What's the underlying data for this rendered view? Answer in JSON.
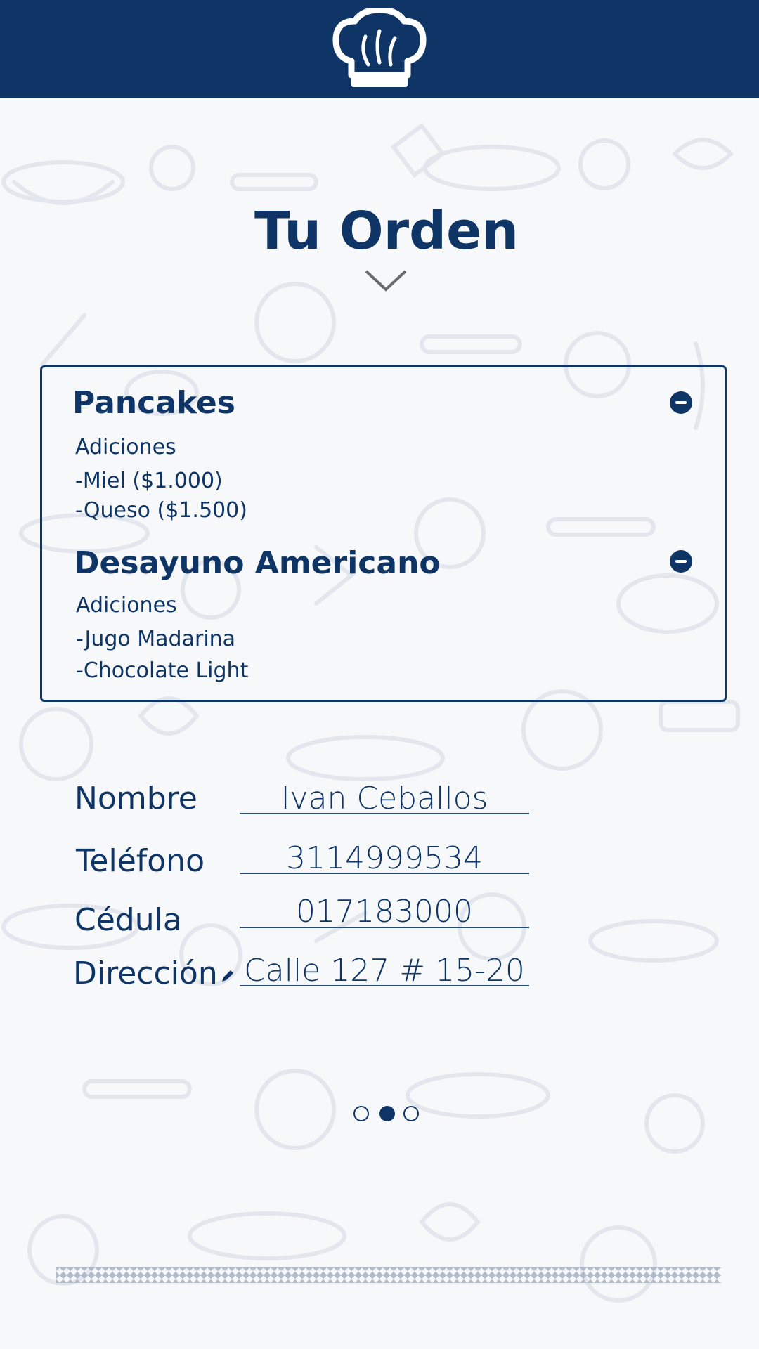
{
  "header": {
    "logo_icon": "chef-hat-icon",
    "background": "#0f3566"
  },
  "page": {
    "title": "Tu Orden",
    "chevron_icon": "chevron-down-icon"
  },
  "order": {
    "items": [
      {
        "name": "Pancakes",
        "additions_title": "Adiciones",
        "additions": [
          "-Miel ($1.000)",
          "-Queso ($1.500)"
        ],
        "remove_icon": "minus-circle-icon"
      },
      {
        "name": "Desayuno Americano",
        "additions_title": "Adiciones",
        "additions": [
          "-Jugo Madarina",
          "-Chocolate Light"
        ],
        "remove_icon": "minus-circle-icon"
      }
    ]
  },
  "form": {
    "name_label": "Nombre",
    "name_value": "Ivan Ceballos",
    "phone_label": "Teléfono",
    "phone_value": "3114999534",
    "id_label": "Cédula",
    "id_value": "017183000",
    "address_label": "Dirección",
    "address_value": "Calle 127 # 15-20",
    "edit_icon": "pencil-icon"
  },
  "pagination": {
    "total": 3,
    "current": 2
  },
  "colors": {
    "primary": "#0f3566",
    "background": "#f7f8fa",
    "pattern": "#e4e8ee"
  }
}
